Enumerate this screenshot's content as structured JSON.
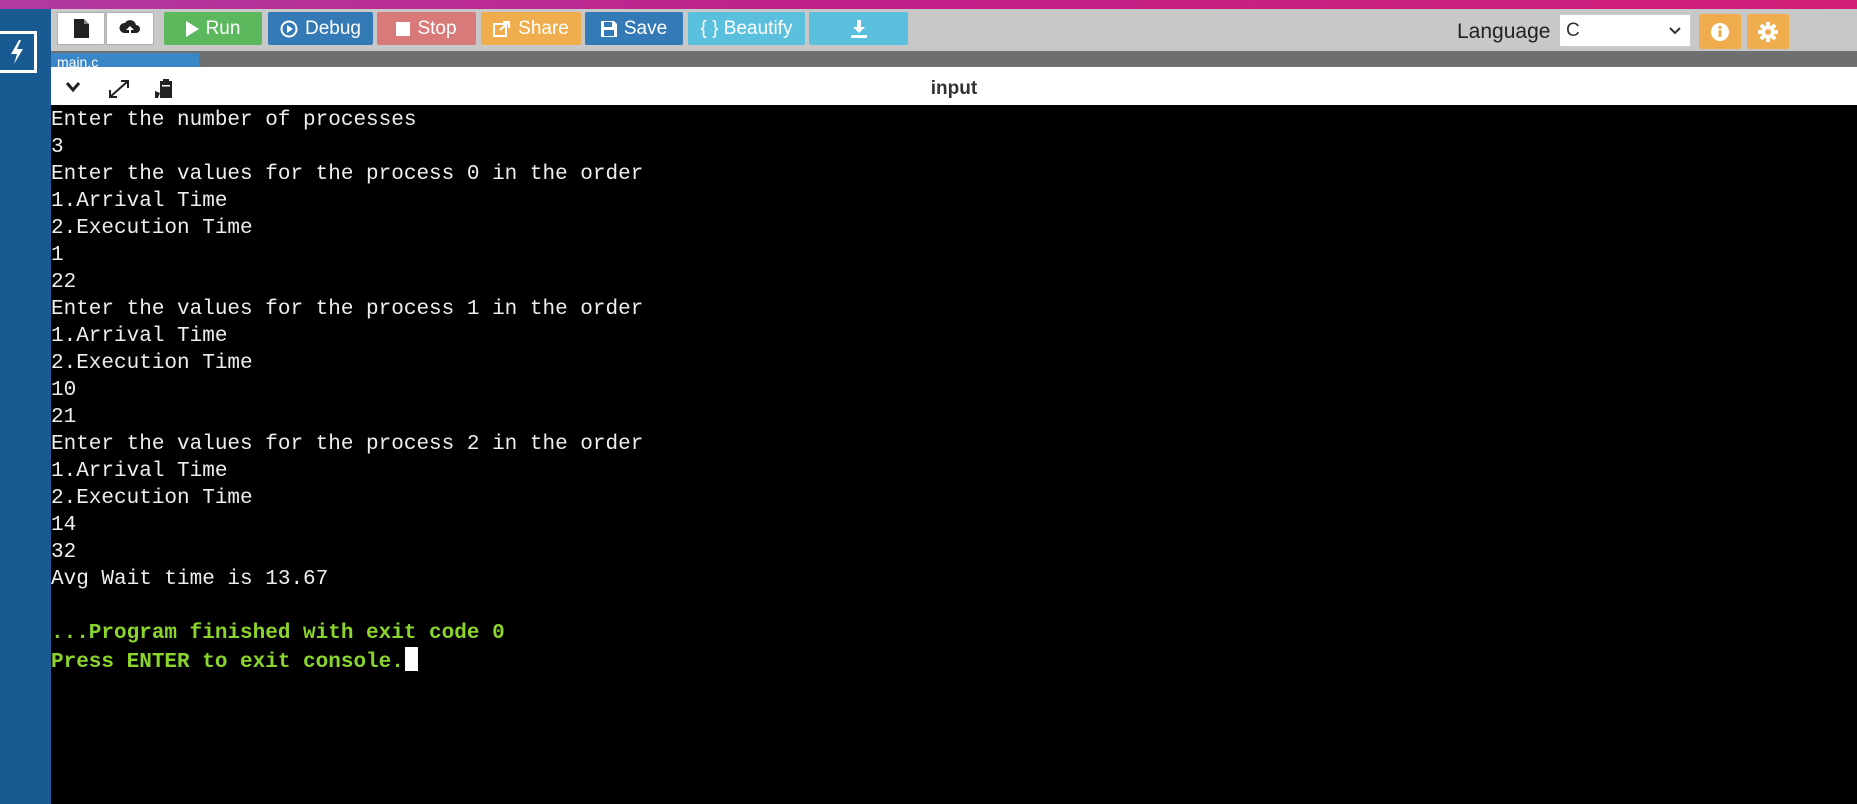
{
  "toolbar": {
    "run_label": "Run",
    "debug_label": "Debug",
    "stop_label": "Stop",
    "share_label": "Share",
    "save_label": "Save",
    "beautify_label": "{ } Beautify",
    "language_label": "Language",
    "language_value": "C"
  },
  "tabs": [
    {
      "label": "main.c"
    }
  ],
  "io_panel": {
    "title": "input"
  },
  "console": {
    "lines": [
      "Enter the number of processes",
      "3",
      "Enter the values for the process 0 in the order",
      "1.Arrival Time",
      "2.Execution Time",
      "1",
      "22",
      "Enter the values for the process 1 in the order",
      "1.Arrival Time",
      "2.Execution Time",
      "10",
      "21",
      "Enter the values for the process 2 in the order",
      "1.Arrival Time",
      "2.Execution Time",
      "14",
      "32",
      "Avg Wait time is 13.67",
      "",
      "...Program finished with exit code 0",
      "Press ENTER to exit console."
    ]
  },
  "colors": {
    "run": "#5cb85c",
    "debug": "#337ab7",
    "stop": "#d97a7a",
    "share": "#f0ad4e",
    "save": "#337ab7",
    "beautify": "#5bc0de",
    "sidebar": "#1a5a93",
    "console_highlight": "#8bd42c"
  }
}
